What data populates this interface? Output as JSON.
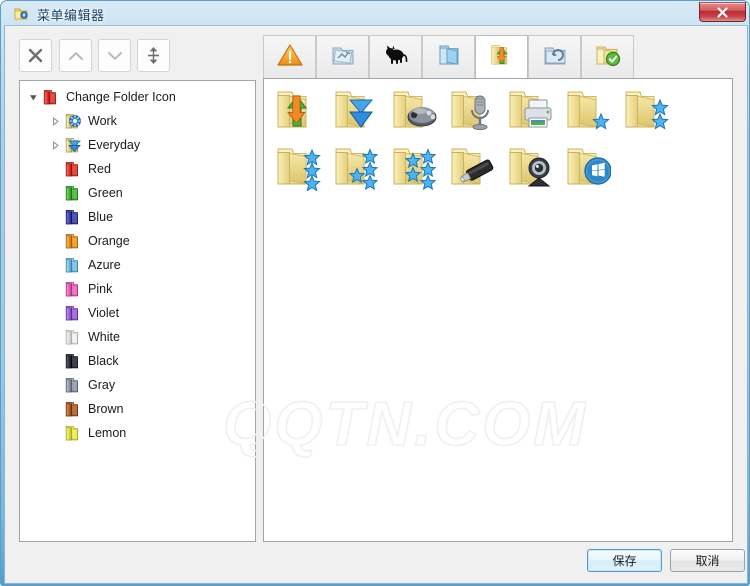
{
  "window": {
    "title": "菜单编辑器",
    "title_icon": "app-folder-icon",
    "close_label": "X",
    "accent_color": "#9ccbe6",
    "frame_color": "#5b9ec9"
  },
  "toolbar": {
    "buttons": [
      {
        "name": "delete-button",
        "icon": "close-x-icon",
        "enabled": true
      },
      {
        "name": "move-up-button",
        "icon": "chevron-up-icon",
        "enabled": false
      },
      {
        "name": "move-down-button",
        "icon": "chevron-down-icon",
        "enabled": false
      },
      {
        "name": "separator-button",
        "icon": "updown-arrows-icon",
        "enabled": true
      }
    ]
  },
  "tree": {
    "items": [
      {
        "label": "Change Folder Icon",
        "depth": 0,
        "expander": "expanded",
        "icon": "folder-red-icon",
        "color": "#e1493d"
      },
      {
        "label": "Work",
        "depth": 1,
        "expander": "collapsed",
        "icon": "folder-gear-icon",
        "color": "#f5dd93"
      },
      {
        "label": "Everyday",
        "depth": 1,
        "expander": "collapsed",
        "icon": "folder-download-icon",
        "color": "#f5dd93"
      },
      {
        "label": "Red",
        "depth": 1,
        "expander": "none",
        "icon": "folder-icon",
        "color": "#e1493d"
      },
      {
        "label": "Green",
        "depth": 1,
        "expander": "none",
        "icon": "folder-icon",
        "color": "#5aba4a"
      },
      {
        "label": "Blue",
        "depth": 1,
        "expander": "none",
        "icon": "folder-icon",
        "color": "#4a54b0"
      },
      {
        "label": "Orange",
        "depth": 1,
        "expander": "none",
        "icon": "folder-icon",
        "color": "#f0a030"
      },
      {
        "label": "Azure",
        "depth": 1,
        "expander": "none",
        "icon": "folder-icon",
        "color": "#7fc4ea"
      },
      {
        "label": "Pink",
        "depth": 1,
        "expander": "none",
        "icon": "folder-icon",
        "color": "#ef72c0"
      },
      {
        "label": "Violet",
        "depth": 1,
        "expander": "none",
        "icon": "folder-icon",
        "color": "#a070d8"
      },
      {
        "label": "White",
        "depth": 1,
        "expander": "none",
        "icon": "folder-icon",
        "color": "#f2f2f2"
      },
      {
        "label": "Black",
        "depth": 1,
        "expander": "none",
        "icon": "folder-icon",
        "color": "#3a3f47"
      },
      {
        "label": "Gray",
        "depth": 1,
        "expander": "none",
        "icon": "folder-icon",
        "color": "#9aa0ad"
      },
      {
        "label": "Brown",
        "depth": 1,
        "expander": "none",
        "icon": "folder-icon",
        "color": "#b5703a"
      },
      {
        "label": "Lemon",
        "depth": 1,
        "expander": "none",
        "icon": "folder-icon",
        "color": "#eeee60"
      }
    ]
  },
  "tabs": {
    "selected_index": 4,
    "items": [
      {
        "name": "tab-warning",
        "icon": "warning-triangle-icon"
      },
      {
        "name": "tab-blue-folder",
        "icon": "folder-blue-scribble-icon"
      },
      {
        "name": "tab-animal",
        "icon": "black-cat-icon"
      },
      {
        "name": "tab-lightblue",
        "icon": "folder-lightblue-icon"
      },
      {
        "name": "tab-transfer",
        "icon": "folder-transfer-icon"
      },
      {
        "name": "tab-undo",
        "icon": "folder-undo-icon"
      },
      {
        "name": "tab-check",
        "icon": "folder-check-icon"
      }
    ]
  },
  "icon_grid": {
    "columns": 7,
    "items": [
      {
        "name": "folder-transfer-icon",
        "badge": "updown-arrows"
      },
      {
        "name": "folder-download-icon",
        "badge": "blue-double-down"
      },
      {
        "name": "folder-games-icon",
        "badge": "gamepad"
      },
      {
        "name": "folder-audio-icon",
        "badge": "microphone"
      },
      {
        "name": "folder-printer-icon",
        "badge": "printer"
      },
      {
        "name": "folder-star1-icon",
        "badge": "one-star"
      },
      {
        "name": "folder-star2-icon",
        "badge": "two-stars"
      },
      {
        "name": "folder-star3-icon",
        "badge": "three-stars"
      },
      {
        "name": "folder-star4-icon",
        "badge": "four-stars"
      },
      {
        "name": "folder-star5-icon",
        "badge": "five-stars"
      },
      {
        "name": "folder-usb-icon",
        "badge": "usb-drive"
      },
      {
        "name": "folder-webcam-icon",
        "badge": "webcam"
      },
      {
        "name": "folder-windows-icon",
        "badge": "windows-logo"
      }
    ]
  },
  "footer": {
    "save_label": "保存",
    "cancel_label": "取消"
  },
  "watermark": {
    "text": "QQTN.COM"
  }
}
